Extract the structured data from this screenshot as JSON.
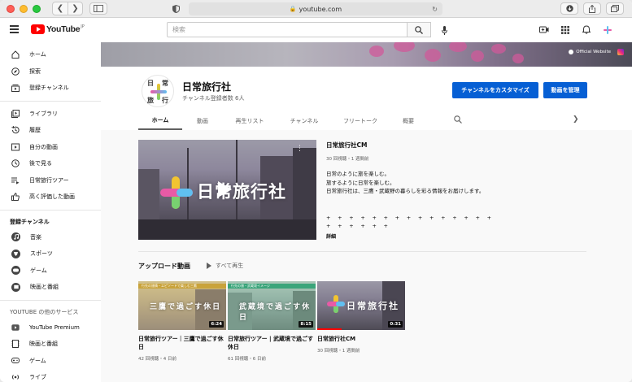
{
  "browser": {
    "url": "youtube.com"
  },
  "header": {
    "logo_text": "YouTube",
    "logo_region": "JP",
    "search_placeholder": "検索"
  },
  "sidebar": {
    "main_items": [
      {
        "label": "ホーム",
        "icon": "home-icon"
      },
      {
        "label": "探索",
        "icon": "compass-icon"
      },
      {
        "label": "登録チャンネル",
        "icon": "subscriptions-icon"
      }
    ],
    "library_items": [
      {
        "label": "ライブラリ",
        "icon": "library-icon"
      },
      {
        "label": "履歴",
        "icon": "history-icon"
      },
      {
        "label": "自分の動画",
        "icon": "my-videos-icon"
      },
      {
        "label": "後で見る",
        "icon": "watch-later-icon"
      },
      {
        "label": "日常旅行ツアー",
        "icon": "playlist-icon"
      },
      {
        "label": "高く評価した動画",
        "icon": "thumbs-up-icon"
      }
    ],
    "subscriptions_heading": "登録チャンネル",
    "subscriptions": [
      {
        "label": "音楽",
        "icon": "music-icon"
      },
      {
        "label": "スポーツ",
        "icon": "sports-icon"
      },
      {
        "label": "ゲーム",
        "icon": "gaming-icon"
      },
      {
        "label": "映画と番組",
        "icon": "movies-icon"
      }
    ],
    "more_heading": "YOUTUBE の他のサービス",
    "more_items": [
      {
        "label": "YouTube Premium",
        "icon": "youtube-premium-icon"
      },
      {
        "label": "映画と番組",
        "icon": "film-icon"
      },
      {
        "label": "ゲーム",
        "icon": "gamepad-icon"
      },
      {
        "label": "ライブ",
        "icon": "live-icon"
      }
    ]
  },
  "banner": {
    "official_label": "Official Website"
  },
  "channel": {
    "name": "日常旅行社",
    "subscribers": "チャンネル登録者数 6人",
    "logo_chars": [
      "日",
      "常",
      "旅",
      "行"
    ],
    "customize_label": "チャンネルをカスタマイズ",
    "manage_label": "動画を管理",
    "accent_color": "#065fd4"
  },
  "tabs": [
    {
      "label": "ホーム",
      "active": true
    },
    {
      "label": "動画",
      "active": false
    },
    {
      "label": "再生リスト",
      "active": false
    },
    {
      "label": "チャンネル",
      "active": false
    },
    {
      "label": "フリートーク",
      "active": false
    },
    {
      "label": "概要",
      "active": false
    }
  ],
  "featured": {
    "thumb_title": "日常旅行社",
    "title": "日常旅行社CM",
    "meta": "30 回視聴・1 週間前",
    "description_lines": [
      "日常のように旅を楽しむ。",
      "旅するように日常を楽しむ。",
      "日常旅行社は、三鷹・武蔵野の暮らしを彩る情報をお届けします。"
    ],
    "plus_line": "+ + + + + + + + + + + + + + + + + + + + +",
    "more_label": "詳細"
  },
  "uploads": {
    "heading": "アップロード動画",
    "play_all": "すべて再生",
    "videos": [
      {
        "title": "日常旅行ツアー｜三鷹で過ごす休日",
        "meta": "42 回視聴・4 日前",
        "duration": "6:24",
        "strip": "行先の旅情・エピソードで楽しむ三鷹",
        "overlay": "三鷹で過ごす休日"
      },
      {
        "title": "日常旅行ツアー | 武蔵境で過ごす休日",
        "meta": "61 回視聴・6 日前",
        "duration": "8:15",
        "strip": "行先の旅・武蔵境イメージ",
        "overlay": "武蔵境で過ごす休日"
      },
      {
        "title": "日常旅行社CM",
        "meta": "30 回視聴・1 週間前",
        "duration": "0:31",
        "strip": "",
        "overlay": "日常旅行社"
      }
    ]
  }
}
